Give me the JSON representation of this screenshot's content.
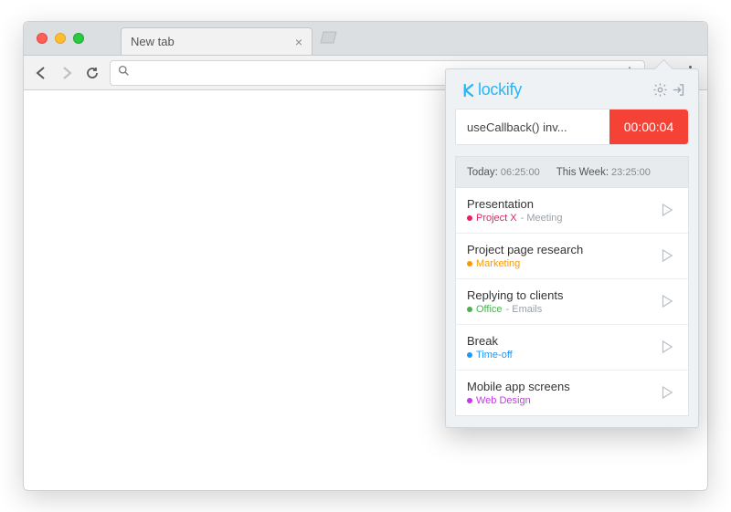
{
  "browser": {
    "tab_title": "New tab",
    "omnibox_value": ""
  },
  "popup": {
    "brand": "lockify",
    "timer": {
      "description": "useCallback() inv...",
      "elapsed": "00:00:04"
    },
    "summary": {
      "today_label": "Today:",
      "today_value": "06:25:00",
      "week_label": "This Week:",
      "week_value": "23:25:00"
    },
    "entries": [
      {
        "title": "Presentation",
        "project": "Project X",
        "client": "Meeting",
        "color": "#e91e63"
      },
      {
        "title": "Project page research",
        "project": "Marketing",
        "client": "",
        "color": "#ff9800"
      },
      {
        "title": "Replying to clients",
        "project": "Office",
        "client": "Emails",
        "color": "#4caf50"
      },
      {
        "title": "Break",
        "project": "Time-off",
        "client": "",
        "color": "#2196f3"
      },
      {
        "title": "Mobile app screens",
        "project": "Web Design",
        "client": "",
        "color": "#c739e8"
      }
    ]
  }
}
